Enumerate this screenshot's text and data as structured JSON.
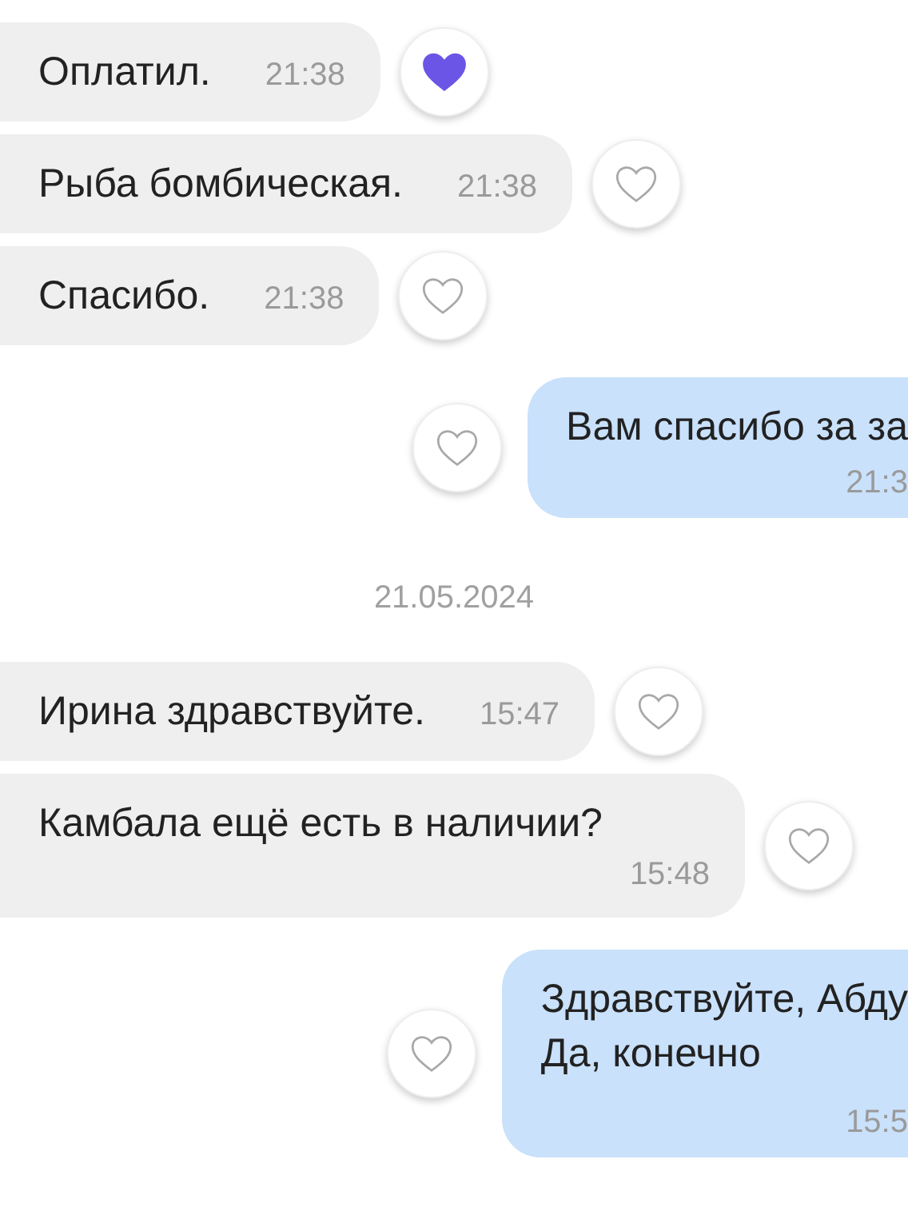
{
  "messages": [
    {
      "kind": "incoming",
      "text": "Оплатил.",
      "time": "21:38",
      "liked": true
    },
    {
      "kind": "incoming",
      "text": "Рыба бомбическая.",
      "time": "21:38",
      "liked": false
    },
    {
      "kind": "incoming",
      "text": "Спасибо.",
      "time": "21:38",
      "liked": false
    },
    {
      "kind": "outgoing",
      "lines": [
        "Вам спасибо за за"
      ],
      "time": "21:3",
      "liked": false
    },
    {
      "kind": "date",
      "text": "21.05.2024"
    },
    {
      "kind": "incoming",
      "text": "Ирина здравствуйте.",
      "time": "15:47",
      "liked": false
    },
    {
      "kind": "incoming",
      "text": "Камбала ещё есть в наличии?",
      "time": "15:48",
      "liked": false
    },
    {
      "kind": "outgoing",
      "lines": [
        "Здравствуйте, Абду",
        "Да, конечно"
      ],
      "time": "15:5",
      "liked": false
    }
  ]
}
